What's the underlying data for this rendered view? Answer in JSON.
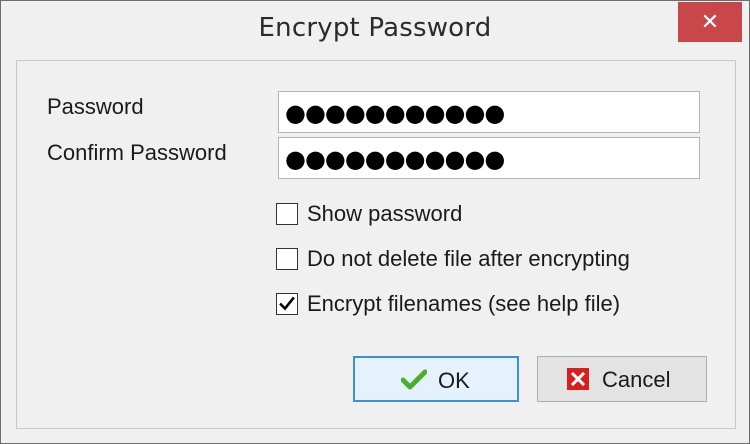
{
  "window": {
    "title": "Encrypt Password",
    "close_glyph": "✕"
  },
  "form": {
    "password_label": "Password",
    "password_value": "●●●●●●●●●●●",
    "confirm_label": "Confirm Password",
    "confirm_value": "●●●●●●●●●●●"
  },
  "options": [
    {
      "label": "Show password",
      "checked": false
    },
    {
      "label": "Do not delete file after encrypting",
      "checked": false
    },
    {
      "label": "Encrypt filenames (see help file)",
      "checked": true
    }
  ],
  "buttons": {
    "ok_label": "OK",
    "ok_icon": "green-checkmark-icon",
    "cancel_label": "Cancel",
    "cancel_icon": "red-x-icon"
  },
  "colors": {
    "close_button_bg": "#c9474a",
    "ok_border": "#3c8fd9",
    "ok_check": "#4caf2a",
    "cancel_x_bg": "#d81e1e"
  }
}
